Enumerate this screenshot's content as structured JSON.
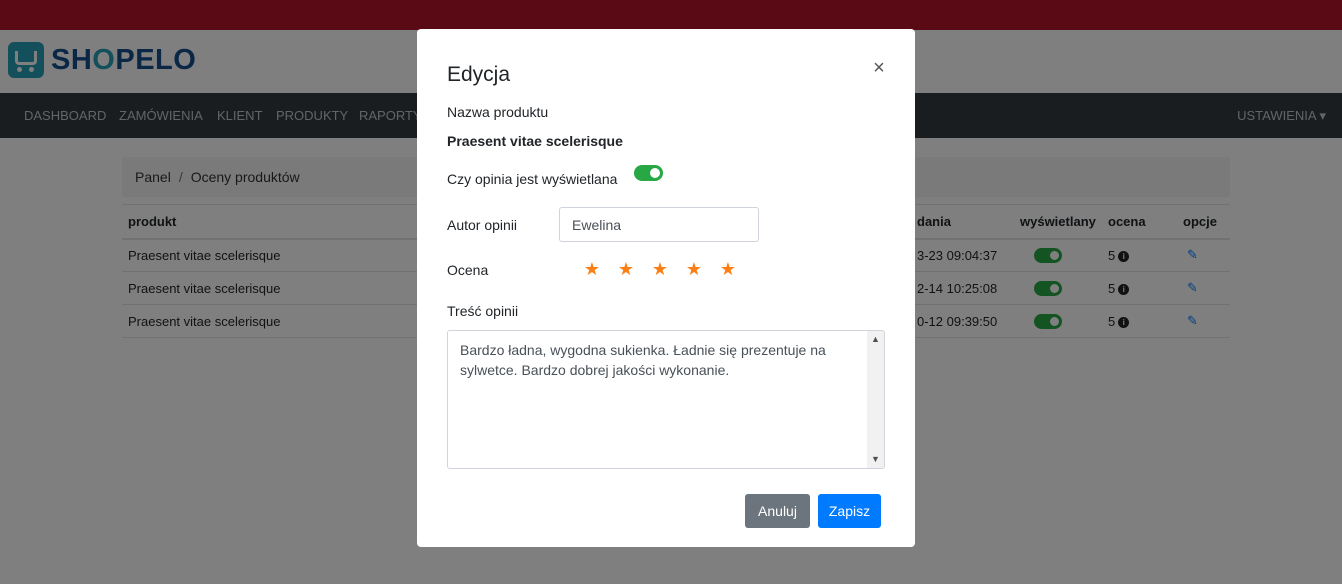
{
  "brand": {
    "name_prefix": "SH",
    "name_o": "O",
    "name_suffix": "PELO"
  },
  "nav": {
    "items": [
      "DASHBOARD",
      "ZAMÓWIENIA",
      "KLIENT",
      "PRODUKTY",
      "RAPORTY"
    ],
    "settings": "USTAWIENIA ▾"
  },
  "breadcrumb": {
    "home": "Panel",
    "separator": "/",
    "current": "Oceny produktów"
  },
  "table": {
    "headers": {
      "product": "produkt",
      "date": "dania",
      "displayed": "wyświetlany",
      "rating": "ocena",
      "options": "opcje"
    },
    "rows": [
      {
        "product": "Praesent vitae scelerisque",
        "date": "3-23 09:04:37",
        "rating": "5"
      },
      {
        "product": "Praesent vitae scelerisque",
        "date": "2-14 10:25:08",
        "rating": "5"
      },
      {
        "product": "Praesent vitae scelerisque",
        "date": "0-12 09:39:50",
        "rating": "5"
      }
    ]
  },
  "modal": {
    "title": "Edycja",
    "close": "×",
    "product_label": "Nazwa produktu",
    "product_name": "Praesent vitae scelerisque",
    "displayed_label": "Czy opinia jest wyświetlana",
    "displayed_on": true,
    "author_label": "Autor opinii",
    "author_value": "Ewelina",
    "rating_label": "Ocena",
    "rating_value": 5,
    "rating_max": 5,
    "content_label": "Treść opinii",
    "content_value": "Bardzo ładna, wygodna sukienka. Ładnie się prezentuje na sylwetce. Bardzo dobrej jakości wykonanie.",
    "cancel": "Anuluj",
    "save": "Zapisz"
  },
  "colors": {
    "topbar": "#b5152b",
    "navbar": "#343a40",
    "toggle_on": "#28a745",
    "star": "#fd7e14",
    "primary": "#007bff",
    "secondary": "#6c757d"
  }
}
